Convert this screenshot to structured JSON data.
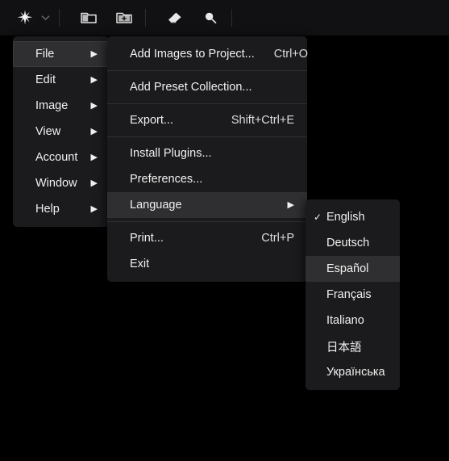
{
  "toolbar": {
    "items": [
      {
        "name": "effects-star-button",
        "icon": "star-icon"
      },
      {
        "name": "effects-dropdown-chevron",
        "icon": "chevron-down-icon"
      },
      {
        "name": "open-folder-button",
        "icon": "folder-icon"
      },
      {
        "name": "add-folder-button",
        "icon": "folder-add-icon"
      },
      {
        "name": "eraser-tool-button",
        "icon": "eraser-icon"
      },
      {
        "name": "zoom-tool-button",
        "icon": "magnifier-icon"
      }
    ]
  },
  "menus": {
    "main": {
      "items": [
        {
          "label": "File",
          "submenu": true,
          "highlighted": true
        },
        {
          "label": "Edit",
          "submenu": true,
          "highlighted": false
        },
        {
          "label": "Image",
          "submenu": true,
          "highlighted": false
        },
        {
          "label": "View",
          "submenu": true,
          "highlighted": false
        },
        {
          "label": "Account",
          "submenu": true,
          "highlighted": false
        },
        {
          "label": "Window",
          "submenu": true,
          "highlighted": false
        },
        {
          "label": "Help",
          "submenu": true,
          "highlighted": false
        }
      ]
    },
    "file": {
      "items": [
        {
          "label": "Add Images to Project...",
          "accel": "Ctrl+O",
          "submenu": false,
          "highlighted": false
        },
        {
          "separator": true
        },
        {
          "label": "Add Preset Collection...",
          "accel": "",
          "submenu": false,
          "highlighted": false
        },
        {
          "separator": true
        },
        {
          "label": "Export...",
          "accel": "Shift+Ctrl+E",
          "submenu": false,
          "highlighted": false
        },
        {
          "separator": true
        },
        {
          "label": "Install Plugins...",
          "accel": "",
          "submenu": false,
          "highlighted": false
        },
        {
          "label": "Preferences...",
          "accel": "",
          "submenu": false,
          "highlighted": false
        },
        {
          "label": "Language",
          "accel": "",
          "submenu": true,
          "highlighted": true
        },
        {
          "separator": true
        },
        {
          "label": "Print...",
          "accel": "Ctrl+P",
          "submenu": false,
          "highlighted": false
        },
        {
          "label": "Exit",
          "accel": "",
          "submenu": false,
          "highlighted": false
        }
      ]
    },
    "language": {
      "items": [
        {
          "label": "English",
          "checked": true,
          "highlighted": false
        },
        {
          "label": "Deutsch",
          "checked": false,
          "highlighted": false
        },
        {
          "label": "Español",
          "checked": false,
          "highlighted": true
        },
        {
          "label": "Français",
          "checked": false,
          "highlighted": false
        },
        {
          "label": "Italiano",
          "checked": false,
          "highlighted": false
        },
        {
          "label": "日本語",
          "checked": false,
          "highlighted": false
        },
        {
          "label": "Українська",
          "checked": false,
          "highlighted": false
        }
      ]
    }
  },
  "glyphs": {
    "submenu_arrow": "▶",
    "check_mark": "✓",
    "chevron_down": "⌄"
  },
  "colors": {
    "app_background": "#000000",
    "toolbar_background": "#111113",
    "menu_background": "#1b1b1d",
    "menu_highlight": "#2f2f31",
    "menu_text": "#f0f0f0",
    "separator": "#303033"
  }
}
